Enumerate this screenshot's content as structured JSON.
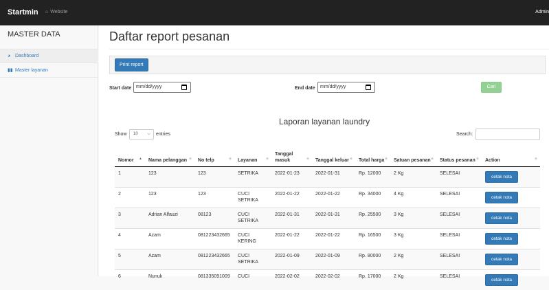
{
  "navbar": {
    "brand": "Startmin",
    "website": "Website",
    "user": "Admin"
  },
  "sidebar": {
    "title": "MASTER DATA",
    "items": [
      {
        "label": "Dashboard",
        "icon": "dashboard-icon"
      },
      {
        "label": "Master layanan",
        "icon": "bar-chart-icon"
      }
    ]
  },
  "main": {
    "title": "Daftar report pesanan",
    "print_label": "Print report",
    "start_label": "Start date",
    "start_placeholder": "mm/dd/yyyy",
    "end_label": "End date",
    "end_placeholder": "mm/dd/yyyy",
    "cari_label": "Cari",
    "report_title": "Laporan layanan laundry",
    "show_label": "Show",
    "entries_value": "10",
    "entries_label": "entries",
    "search_label": "Search:"
  },
  "table": {
    "headers": [
      "Nomor",
      "Nama pelanggan",
      "No telp",
      "Layanan",
      "Tanggal masuk",
      "Tanggal keluar",
      "Total harga",
      "Satuan pesanan",
      "Status pesanan",
      "Action"
    ],
    "rows": [
      [
        "1",
        "123",
        "123",
        "SETRIKA",
        "2022-01-23",
        "2022-01-31",
        "Rp. 12000",
        "2 Kg",
        "SELESAI"
      ],
      [
        "2",
        "123",
        "123",
        "CUCI SETRIKA",
        "2022-01-22",
        "2022-01-22",
        "Rp. 34000",
        "4 Kg",
        "SELESAI"
      ],
      [
        "3",
        "Adrian Alfauzi",
        "08123",
        "CUCI SETRIKA",
        "2022-01-31",
        "2022-01-31",
        "Rp. 25500",
        "3 Kg",
        "SELESAI"
      ],
      [
        "4",
        "Azam",
        "081223432665",
        "CUCI KERING",
        "2022-01-22",
        "2022-01-22",
        "Rp. 16500",
        "3 Kg",
        "SELESAI"
      ],
      [
        "5",
        "Azam",
        "081223432665",
        "CUCI SETRIKA",
        "2022-01-09",
        "2022-01-09",
        "Rp. 80000",
        "2 Kg",
        "SELESAI"
      ],
      [
        "6",
        "Nunuk",
        "081335091009",
        "CUCI",
        "2022-02-02",
        "2022-02-02",
        "Rp. 17000",
        "2 Kg",
        "SELESAI"
      ]
    ],
    "action_label": "cetak nota"
  }
}
